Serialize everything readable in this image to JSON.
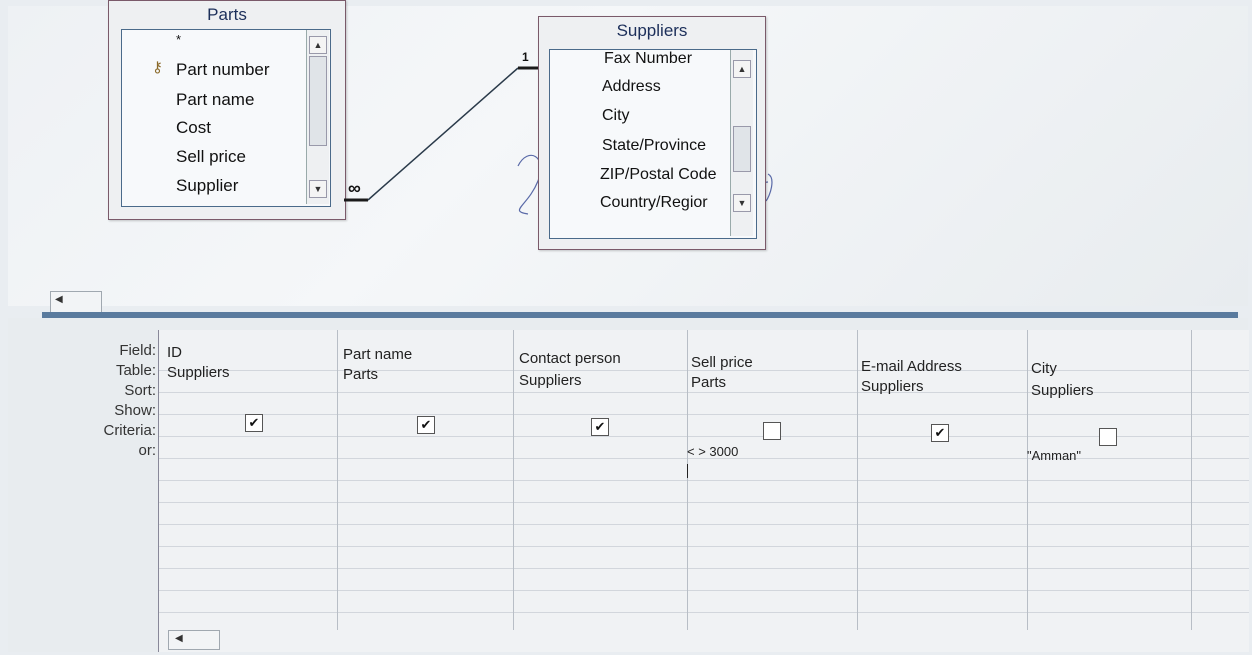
{
  "diagram": {
    "parts_table": {
      "title": "Parts",
      "fields": [
        "*",
        "Part number",
        "Part name",
        "Cost",
        "Sell price",
        "Supplier"
      ],
      "key_icon": "key-icon"
    },
    "suppliers_table": {
      "title": "Suppliers",
      "fields": [
        "Fax Number",
        "Address",
        "City",
        "State/Province",
        "ZIP/Postal Code",
        "Country/Regior"
      ]
    },
    "relationship": {
      "one_side": "1",
      "many_side": "∞"
    }
  },
  "grid": {
    "row_labels": {
      "field": "Field:",
      "table": "Table:",
      "sort": "Sort:",
      "show": "Show:",
      "criteria": "Criteria:",
      "or": "or:"
    },
    "columns": [
      {
        "field": "ID",
        "table": "Suppliers",
        "show": true,
        "criteria": ""
      },
      {
        "field": "Part name",
        "table": "Parts",
        "show": true,
        "criteria": ""
      },
      {
        "field": "Contact person",
        "table": "Suppliers",
        "show": true,
        "criteria": ""
      },
      {
        "field": "Sell price",
        "table": "Parts",
        "show": false,
        "criteria": "< > 3000"
      },
      {
        "field": "E-mail Address",
        "table": "Suppliers",
        "show": true,
        "criteria": ""
      },
      {
        "field": "City",
        "table": "Suppliers",
        "show": false,
        "criteria": "\"Amman\""
      }
    ]
  },
  "colors": {
    "splitter": "#5a7b9e",
    "table_border": "#7a5a6a",
    "relationship_line": "#2a3a4a"
  }
}
